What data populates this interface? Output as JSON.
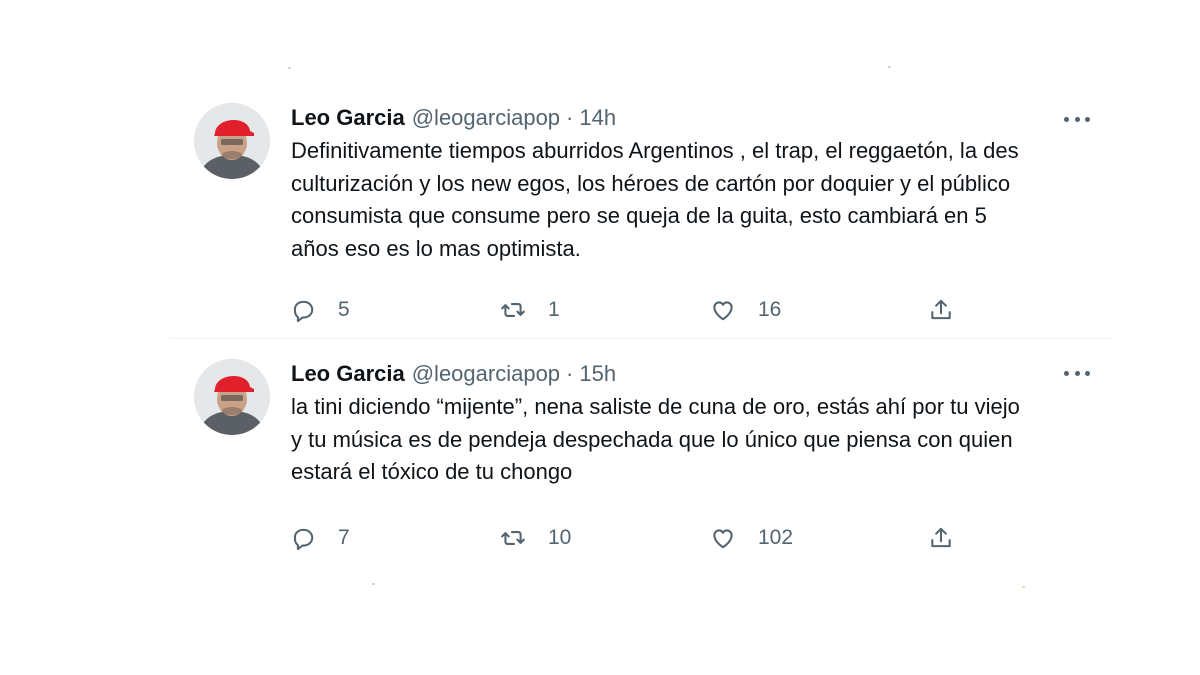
{
  "tweets": [
    {
      "name": "Leo Garcia",
      "handle": "@leogarciapop",
      "separator": "·",
      "time": "14h",
      "text": "Definitivamente tiempos aburridos Argentinos , el trap, el reggaetón, la des\nculturización y los new egos, los héroes de cartón por doquier y el público\nconsumista que consume pero se queja de la guita, esto cambiará en 5\naños eso es lo mas optimista.",
      "replies": "5",
      "retweets": "1",
      "likes": "16"
    },
    {
      "name": "Leo Garcia",
      "handle": "@leogarciapop",
      "separator": "·",
      "time": "15h",
      "text": "la tini diciendo “mijente”, nena saliste de cuna de oro, estás ahí por tu viejo\ny tu música es de pendeja despechada que lo único que piensa con quien\nestará el tóxico de tu chongo",
      "replies": "7",
      "retweets": "10",
      "likes": "102"
    }
  ],
  "icons": {
    "more": "more-horizontal-icon",
    "reply": "reply-bubble-icon",
    "retweet": "retweet-icon",
    "like": "heart-icon",
    "share": "share-icon"
  },
  "colors": {
    "text": "#0f1419",
    "secondary": "#536471",
    "divider": "#eff3f4",
    "avatar_cap": "#e0202a"
  }
}
